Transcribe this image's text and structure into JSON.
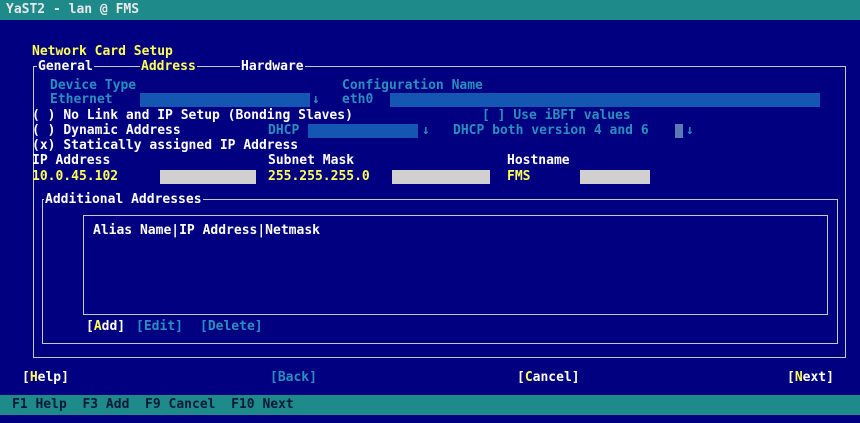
{
  "window": {
    "title": "YaST2 - lan @ FMS"
  },
  "dialog": {
    "title": "Network Card Setup"
  },
  "tabs": [
    {
      "label": "General"
    },
    {
      "label": "Address"
    },
    {
      "label": "Hardware"
    }
  ],
  "device": {
    "type_label": "Device Type",
    "type_value": "Ethernet",
    "config_label": "Configuration Name",
    "config_value": "eth0"
  },
  "options": {
    "no_link": {
      "mark": "( )",
      "text": "No Link and IP Setup (Bonding Slaves)"
    },
    "ibft": {
      "mark": "[ ]",
      "text": "Use iBFT values"
    },
    "dynamic": {
      "mark": "( )",
      "text": "Dynamic Address"
    },
    "dhcp_value": "DHCP",
    "dhcp_version": "DHCP both version 4 and 6",
    "static": {
      "mark": "(x)",
      "text": "Statically assigned IP Address"
    }
  },
  "static": {
    "ip_label": "IP Address",
    "ip_value": "10.0.45.102",
    "mask_label": "Subnet Mask",
    "mask_value": "255.255.255.0",
    "hostname_label": "Hostname",
    "hostname_value": "FMS"
  },
  "additional": {
    "title": "Additional Addresses",
    "header": "Alias Name|IP Address|Netmask",
    "add": "[Add]",
    "edit": "[Edit]",
    "delete": "[Delete]"
  },
  "buttons": {
    "help": "[Help]",
    "back": "[Back]",
    "cancel": "[Cancel]",
    "next": "[Next]"
  },
  "hotkeys": "F1 Help  F3 Add  F9 Cancel  F10 Next",
  "colors": {
    "background": "#000080",
    "titlebar": "#1f8a8a",
    "highlight": "#ffff55",
    "field": "#1457b3"
  }
}
